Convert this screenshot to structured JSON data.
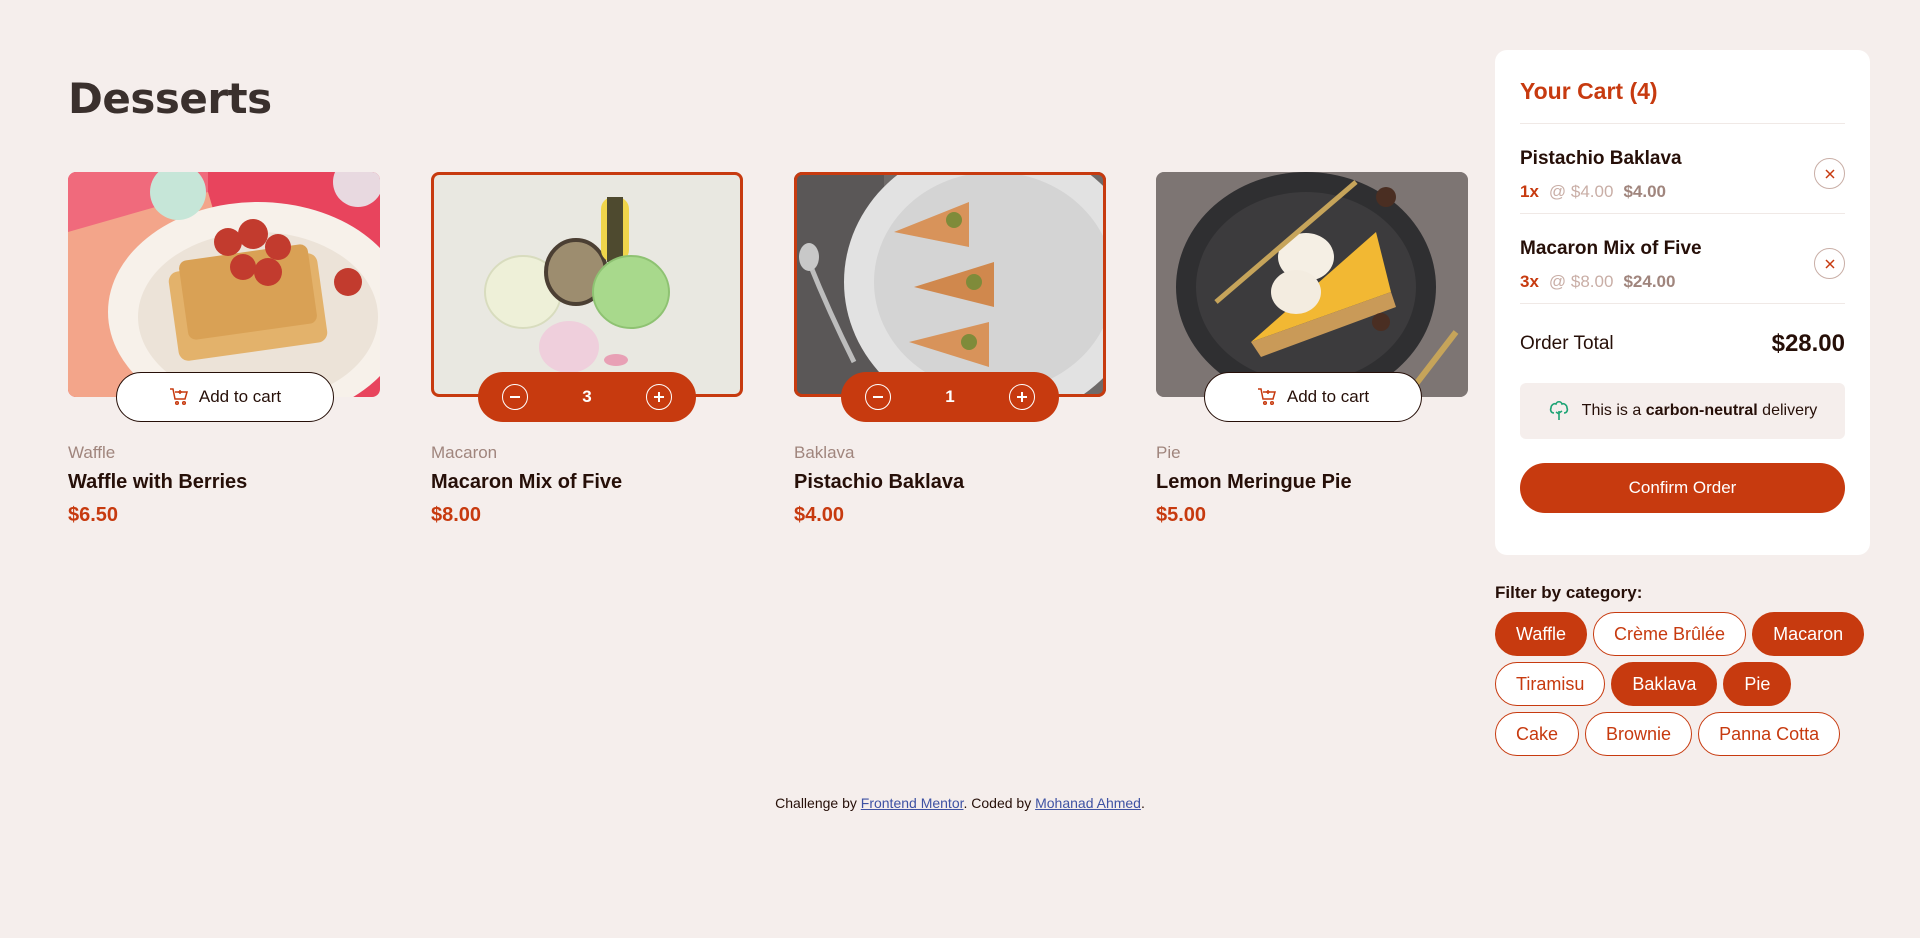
{
  "page": {
    "title": "Desserts"
  },
  "products": [
    {
      "category": "Waffle",
      "name": "Waffle with Berries",
      "price": "$6.50",
      "state": "add",
      "add_label": "Add to cart"
    },
    {
      "category": "Macaron",
      "name": "Macaron Mix of Five",
      "price": "$8.00",
      "state": "qty",
      "qty": "3"
    },
    {
      "category": "Baklava",
      "name": "Pistachio Baklava",
      "price": "$4.00",
      "state": "qty",
      "qty": "1"
    },
    {
      "category": "Pie",
      "name": "Lemon Meringue Pie",
      "price": "$5.00",
      "state": "add",
      "add_label": "Add to cart"
    }
  ],
  "cart": {
    "title": "Your Cart (4)",
    "items": [
      {
        "name": "Pistachio Baklava",
        "qty": "1x",
        "unit": "@ $4.00",
        "subtotal": "$4.00"
      },
      {
        "name": "Macaron Mix of Five",
        "qty": "3x",
        "unit": "@ $8.00",
        "subtotal": "$24.00"
      }
    ],
    "total_label": "Order Total",
    "total_value": "$28.00",
    "carbon_pre": "This is a",
    "carbon_bold": "carbon-neutral",
    "carbon_post": "delivery",
    "confirm_label": "Confirm Order"
  },
  "filter": {
    "title": "Filter by category:",
    "chips": [
      {
        "label": "Waffle",
        "active": true
      },
      {
        "label": "Crème Brûlée",
        "active": false
      },
      {
        "label": "Macaron",
        "active": true
      },
      {
        "label": "Tiramisu",
        "active": false
      },
      {
        "label": "Baklava",
        "active": true
      },
      {
        "label": "Pie",
        "active": true
      },
      {
        "label": "Cake",
        "active": false
      },
      {
        "label": "Brownie",
        "active": false
      },
      {
        "label": "Panna Cotta",
        "active": false
      }
    ]
  },
  "footer": {
    "pre": "Challenge by",
    "link1": "Frontend Mentor",
    "mid": ". Coded by",
    "link2": "Mohanad Ahmed",
    "post": "."
  },
  "colors": {
    "accent": "#c73a0f",
    "background": "#f5eeec",
    "text": "#260f08",
    "green": "#1ea475"
  }
}
